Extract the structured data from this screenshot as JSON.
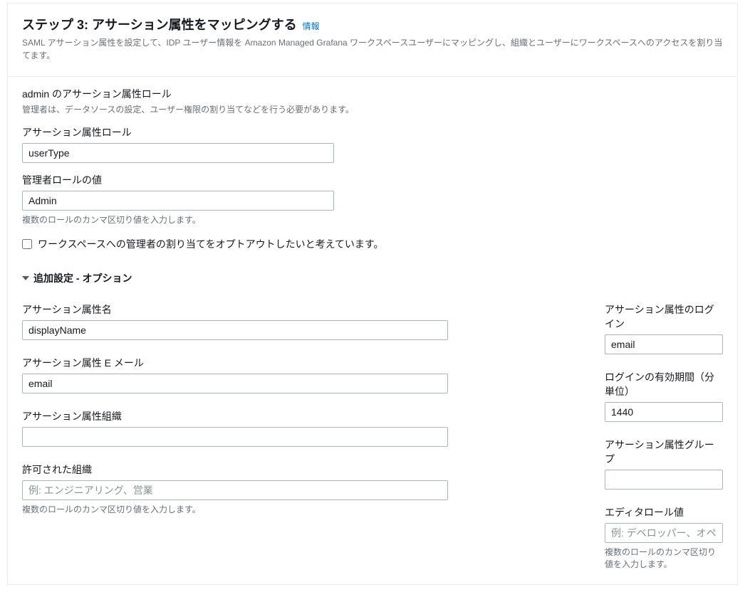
{
  "header": {
    "step_title": "ステップ 3: アサーション属性をマッピングする",
    "info_label": "情報",
    "step_desc": "SAML アサーション属性を設定して、IDP ユーザー情報を Amazon Managed Grafana ワークスペースユーザーにマッピングし、組織とユーザーにワークスペースへのアクセスを割り当てます。"
  },
  "admin_section": {
    "title": "admin のアサーション属性ロール",
    "desc": "管理者は、データソースの設定、ユーザー権限の割り当てなどを行う必要があります。",
    "role_label": "アサーション属性ロール",
    "role_value": "userType",
    "admin_value_label": "管理者ロールの値",
    "admin_value": "Admin",
    "admin_value_hint": "複数のロールのカンマ区切り値を入力します。",
    "optout_label": "ワークスペースへの管理者の割り当てをオプトアウトしたいと考えています。"
  },
  "expander": {
    "label": "追加設定 - オプション"
  },
  "left": {
    "attr_name_label": "アサーション属性名",
    "attr_name_value": "displayName",
    "attr_email_label": "アサーション属性 E メール",
    "attr_email_value": "email",
    "attr_org_label": "アサーション属性組織",
    "attr_org_value": "",
    "allowed_org_label": "許可された組織",
    "allowed_org_placeholder": "例: エンジニアリング、営業",
    "allowed_org_hint": "複数のロールのカンマ区切り値を入力します。"
  },
  "right": {
    "attr_login_label": "アサーション属性のログイン",
    "attr_login_value": "email",
    "login_duration_label": "ログインの有効期間（分単位）",
    "login_duration_value": "1440",
    "attr_group_label": "アサーション属性グループ",
    "attr_group_value": "",
    "editor_value_label": "エディタロール値",
    "editor_value_placeholder": "例: デベロッパー、オペレーター",
    "editor_value_hint": "複数のロールのカンマ区切り値を入力します。"
  }
}
